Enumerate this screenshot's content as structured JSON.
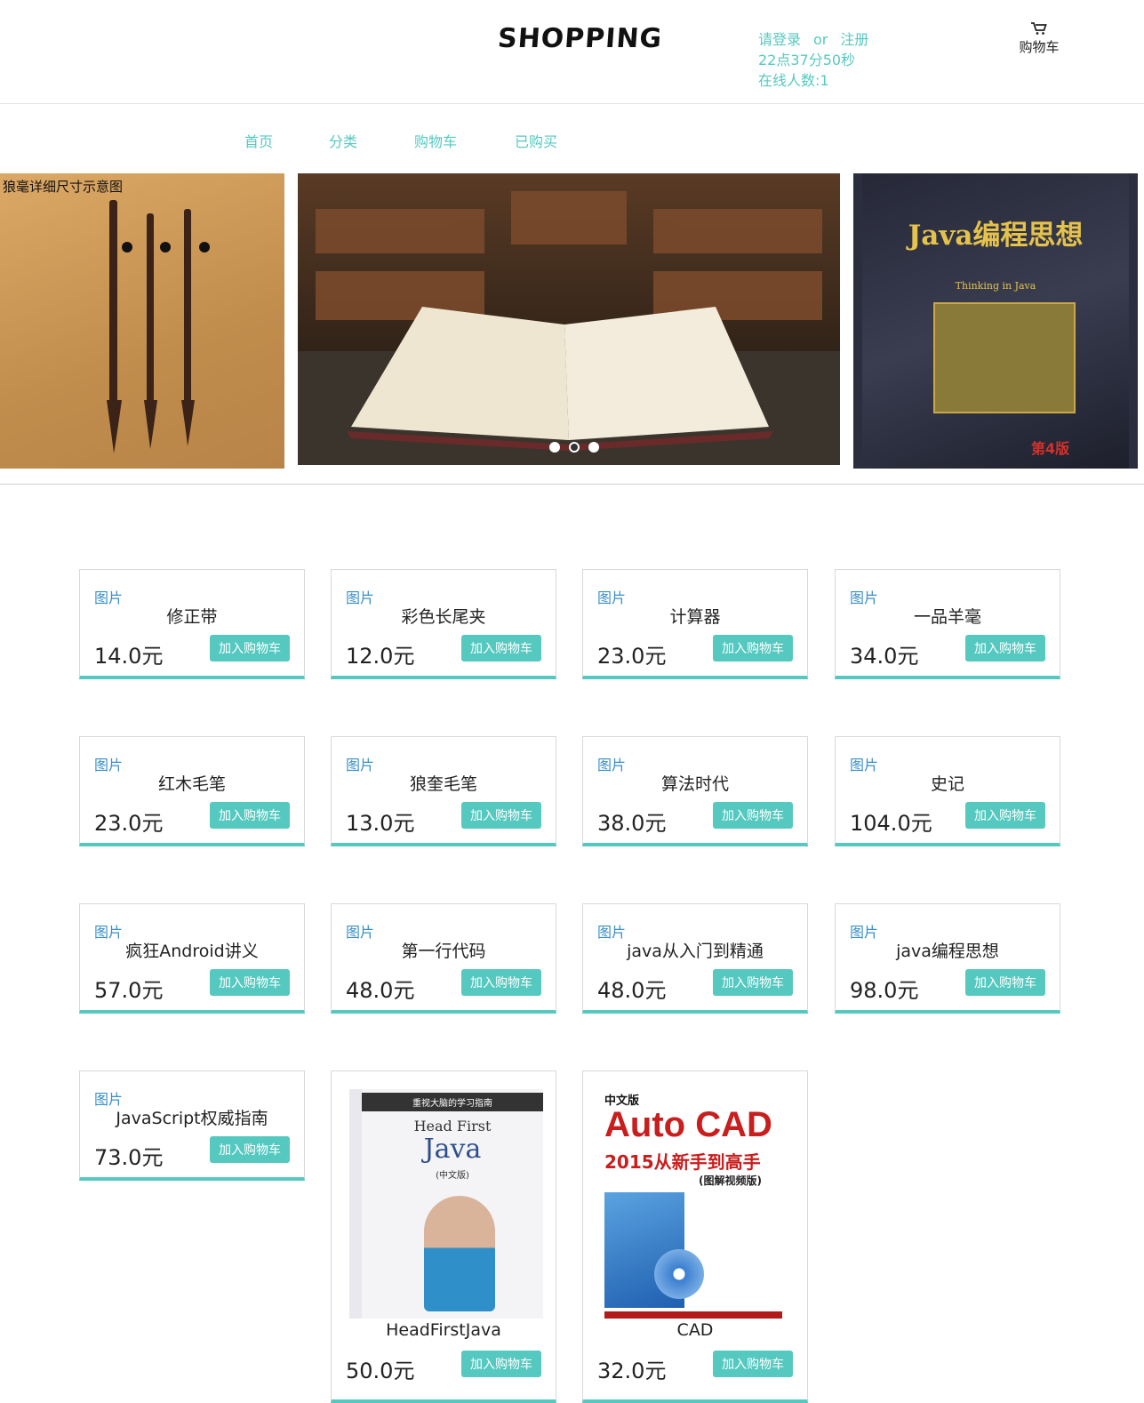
{
  "header": {
    "logo": "SHOPPING",
    "login": "请登录",
    "or": "or",
    "register": "注册",
    "time": "22点37分50秒",
    "online": "在线人数:1",
    "cart_label": "购物车"
  },
  "nav": {
    "items": [
      "首页",
      "分类",
      "购物车",
      "已购买"
    ]
  },
  "carousel": {
    "left_caption": "狼毫详细尺寸示意图",
    "right_title": "Java编程思想",
    "right_subtitle": "Thinking in Java",
    "right_edition": "第4版",
    "dots": 3,
    "active_dot": 1
  },
  "products": [
    {
      "name": "修正带",
      "price": "14.0元",
      "img": "图片",
      "btn": "加入购物车"
    },
    {
      "name": "彩色长尾夹",
      "price": "12.0元",
      "img": "图片",
      "btn": "加入购物车"
    },
    {
      "name": "计算器",
      "price": "23.0元",
      "img": "图片",
      "btn": "加入购物车"
    },
    {
      "name": "一品羊毫",
      "price": "34.0元",
      "img": "图片",
      "btn": "加入购物车"
    },
    {
      "name": "红木毛笔",
      "price": "23.0元",
      "img": "图片",
      "btn": "加入购物车"
    },
    {
      "name": "狼奎毛笔",
      "price": "13.0元",
      "img": "图片",
      "btn": "加入购物车"
    },
    {
      "name": "算法时代",
      "price": "38.0元",
      "img": "图片",
      "btn": "加入购物车"
    },
    {
      "name": "史记",
      "price": "104.0元",
      "img": "图片",
      "btn": "加入购物车"
    },
    {
      "name": "疯狂Android讲义",
      "price": "57.0元",
      "img": "图片",
      "btn": "加入购物车"
    },
    {
      "name": "第一行代码",
      "price": "48.0元",
      "img": "图片",
      "btn": "加入购物车"
    },
    {
      "name": "java从入门到精通",
      "price": "48.0元",
      "img": "图片",
      "btn": "加入购物车"
    },
    {
      "name": "java编程思想",
      "price": "98.0元",
      "img": "图片",
      "btn": "加入购物车"
    },
    {
      "name": "JavaScript权威指南",
      "price": "73.0元",
      "img": "图片",
      "btn": "加入购物车"
    },
    {
      "name": "HeadFirstJava",
      "price": "50.0元",
      "btn": "加入购物车",
      "cover": {
        "top": "重视大脑的学习指南",
        "title1": "Head First",
        "title2": "Java",
        "sub": "(中文版)"
      }
    },
    {
      "name": "CAD",
      "price": "32.0元",
      "btn": "加入购物车",
      "cover": {
        "tag": "中文版",
        "title1": "Auto CAD",
        "title2": "2015从新手到高手",
        "sub": "(图解视频版)"
      }
    }
  ],
  "colors": {
    "accent": "#55c9c0",
    "link": "#3a8fc7"
  }
}
